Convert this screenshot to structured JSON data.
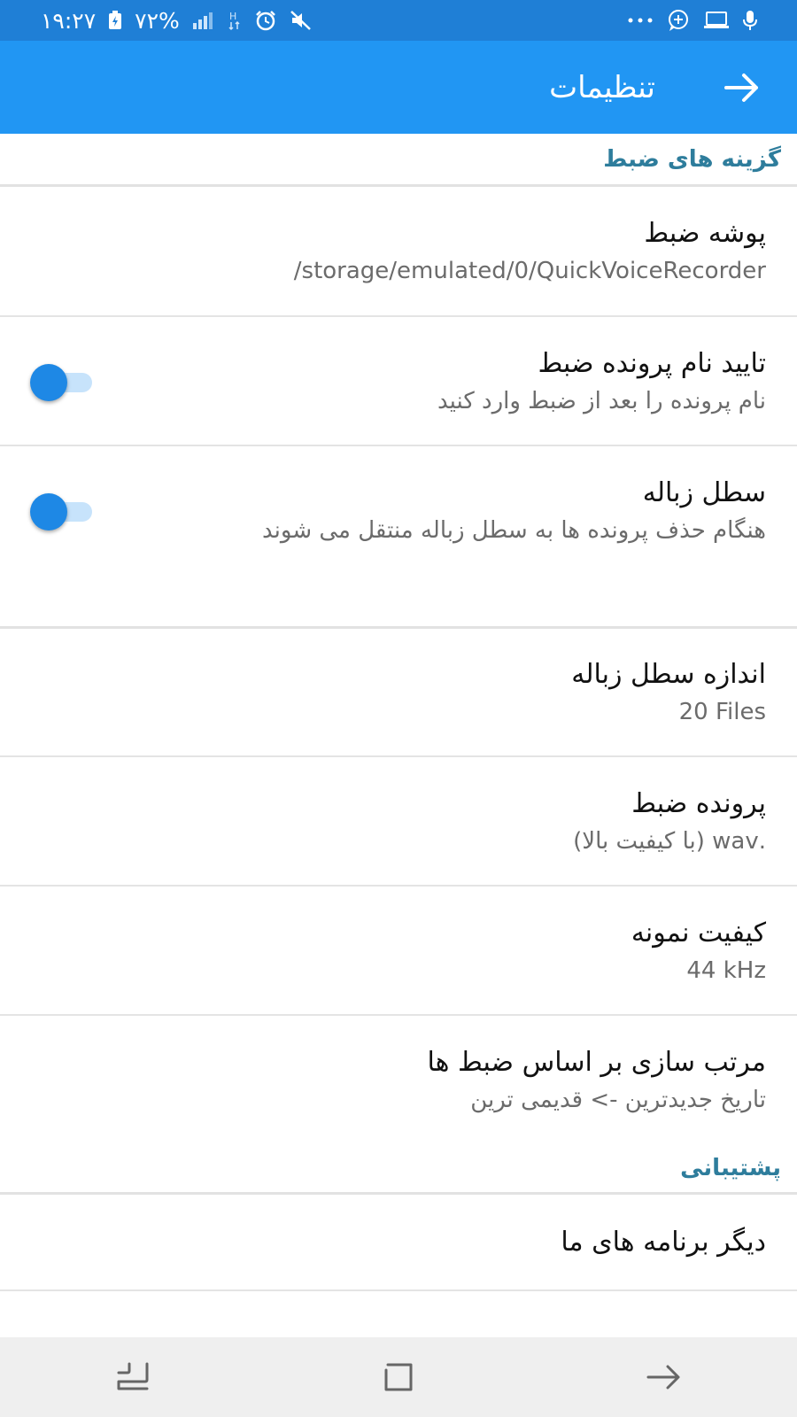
{
  "status": {
    "time": "۱۹:۲۷",
    "battery": "۷۲%"
  },
  "appbar": {
    "title": "تنظیمات"
  },
  "sections": {
    "recording_header": "گزینه های ضبط",
    "support_header": "پشتیبانی"
  },
  "items": {
    "folder": {
      "title": "پوشه ضبط",
      "value": "/storage/emulated/0/QuickVoiceRecorder"
    },
    "confirm_name": {
      "title": "تایید نام پرونده ضبط",
      "value": "نام پرونده را بعد از ضبط وارد کنید"
    },
    "trash": {
      "title": "سطل زباله",
      "value": "هنگام حذف پرونده ها به سطل زباله منتقل می شوند"
    },
    "trash_size": {
      "title": "اندازه سطل زباله",
      "value": "20 Files"
    },
    "format": {
      "title": "پرونده ضبط",
      "value": ".wav (با کیفیت بالا)"
    },
    "sample_rate": {
      "title": "کیفیت نمونه",
      "value": "44 kHz"
    },
    "sort": {
      "title": "مرتب سازی بر اساس ضبط ها",
      "value": "تاریخ جدیدترین -> قدیمی ترین"
    },
    "other_apps": {
      "title": "دیگر برنامه های ما"
    }
  },
  "colors": {
    "status_bar": "#1f7fd6",
    "app_bar": "#2196f3",
    "accent": "#1e88e5",
    "section_text": "#2e7d9c"
  }
}
